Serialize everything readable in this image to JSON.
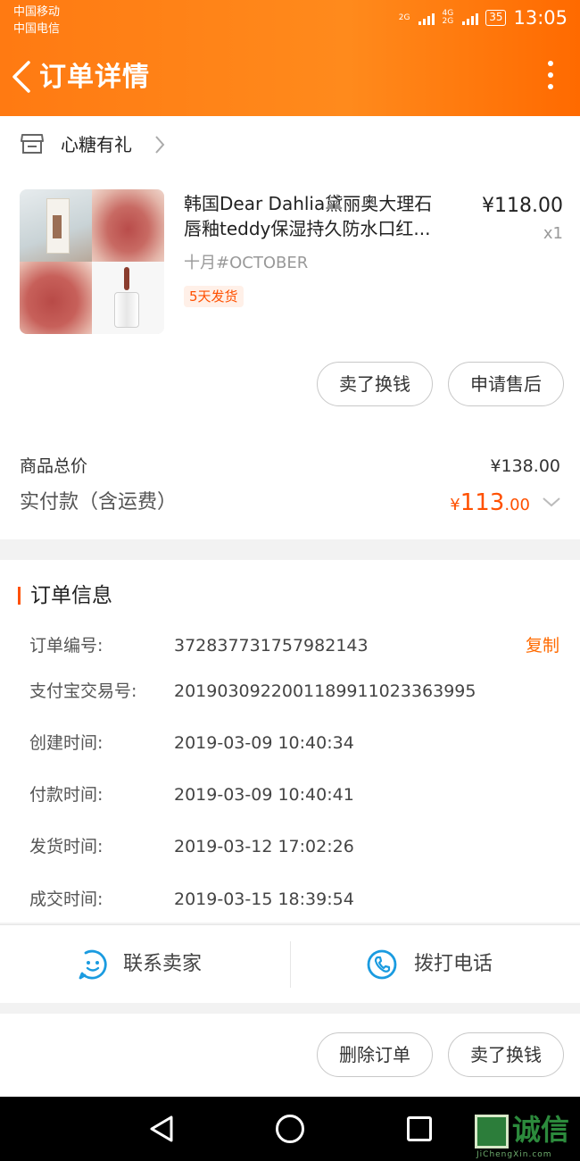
{
  "status_bar": {
    "carrier1": "中国移动",
    "carrier2": "中国电信",
    "net1": "2G",
    "net2": "4G\n2G",
    "battery": "35",
    "time": "13:05"
  },
  "header": {
    "title": "订单详情"
  },
  "store": {
    "name": "心糖有礼"
  },
  "product": {
    "title_line1": "韩国Dear Dahlia黛丽奥大理石",
    "title_line2": "唇釉teddy保湿持久防水口红...",
    "price": "¥118.00",
    "qty": "x1",
    "sku": "十月#OCTOBER",
    "ship_badge": "5天发货"
  },
  "order_buttons": {
    "sell": "卖了换钱",
    "after_sales": "申请售后"
  },
  "totals": {
    "goods_total_label": "商品总价",
    "goods_total_value": "¥138.00",
    "paid_label": "实付款（含运费）",
    "paid_currency": "¥",
    "paid_int": "113",
    "paid_dec": ".00"
  },
  "info": {
    "title": "订单信息",
    "copy": "复制",
    "rows": [
      {
        "label": "订单编号:",
        "value": "372837731757982143"
      },
      {
        "label": "支付宝交易号:",
        "value": "2019030922001189911023363995"
      },
      {
        "label": "创建时间:",
        "value": "2019-03-09 10:40:34"
      },
      {
        "label": "付款时间:",
        "value": "2019-03-09 10:40:41"
      },
      {
        "label": "发货时间:",
        "value": "2019-03-12 17:02:26"
      },
      {
        "label": "成交时间:",
        "value": "2019-03-15 18:39:54"
      }
    ]
  },
  "contact": {
    "seller": "联系卖家",
    "call": "拨打电话"
  },
  "bottom_actions": {
    "delete": "删除订单",
    "sell": "卖了换钱"
  },
  "watermark": {
    "text": "诚信",
    "sub": "JiChengXin.com"
  },
  "colors": {
    "brand_orange": "#ff6a00",
    "price_orange": "#ff5000",
    "icon_blue": "#1a9be0"
  }
}
